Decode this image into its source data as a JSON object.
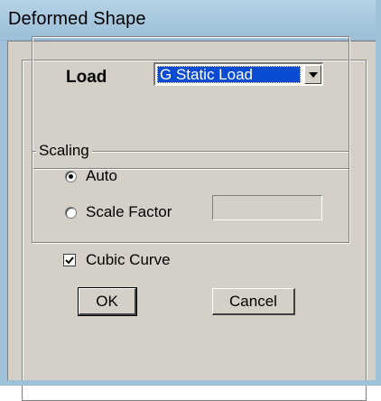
{
  "window": {
    "title": "Deformed Shape"
  },
  "load": {
    "label": "Load",
    "selected_value": "G Static Load"
  },
  "scaling": {
    "legend": "Scaling",
    "options": [
      {
        "label": "Auto",
        "selected": true
      },
      {
        "label": "Scale Factor",
        "selected": false
      }
    ],
    "scale_factor_value": ""
  },
  "cubic_curve": {
    "label": "Cubic Curve",
    "checked": true
  },
  "buttons": {
    "ok_label": "OK",
    "cancel_label": "Cancel"
  },
  "colors": {
    "dialog_face": "#d4d0c8",
    "title_bar": "#a6c7de",
    "selection": "#0a4bd4"
  }
}
